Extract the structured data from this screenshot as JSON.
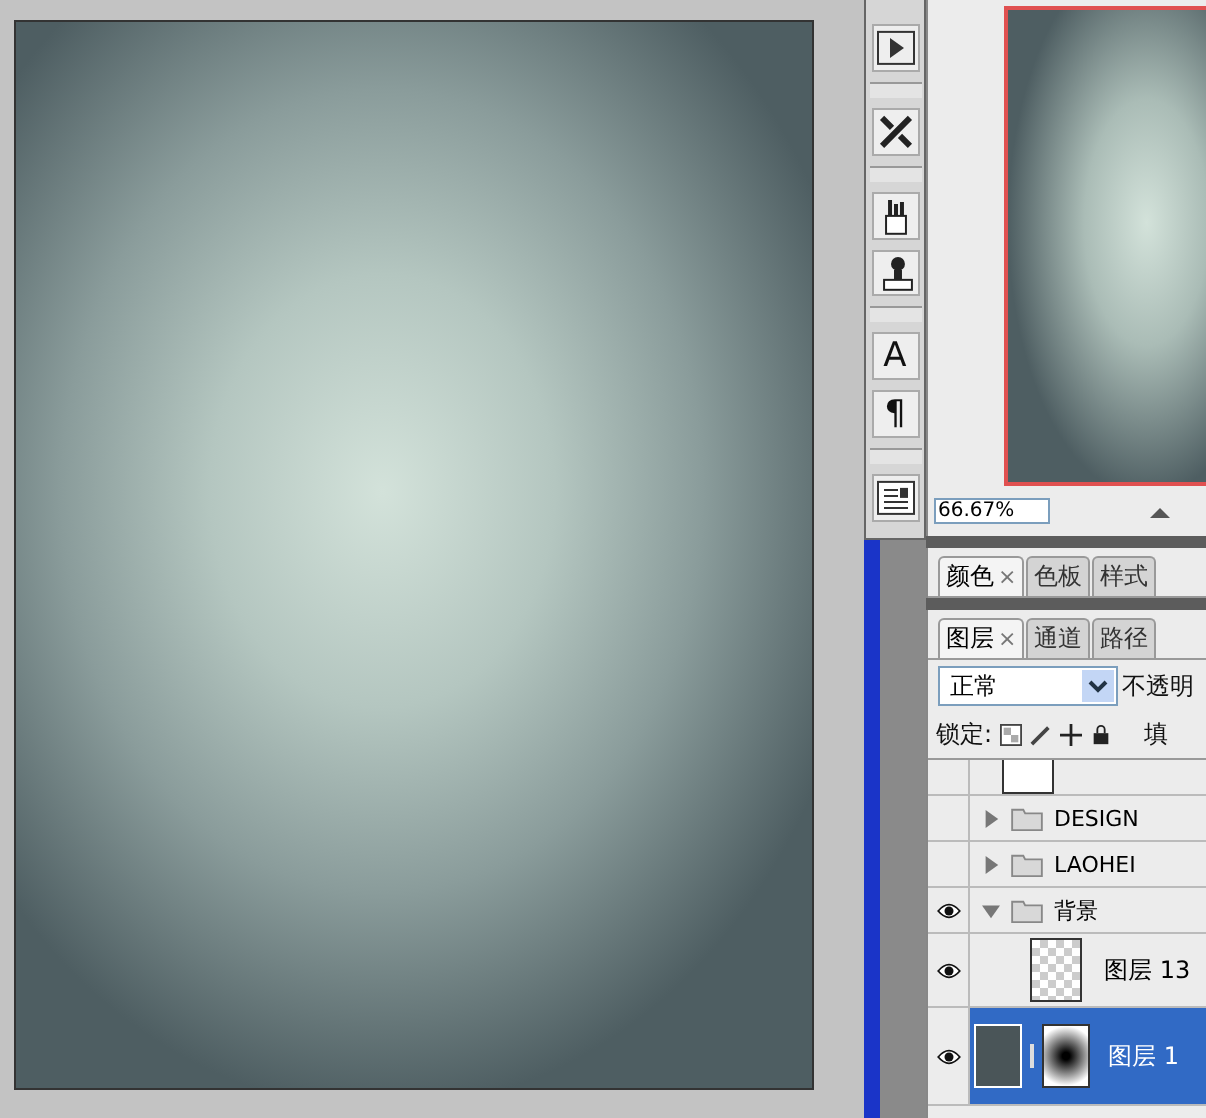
{
  "toolbar": [
    {
      "kind": "play"
    },
    {
      "kind": "tools"
    },
    {
      "kind": "brushes"
    },
    {
      "kind": "stamp"
    },
    {
      "kind": "glyph",
      "label": "A"
    },
    {
      "kind": "glyph",
      "label": "¶"
    },
    {
      "kind": "notes"
    }
  ],
  "navigator": {
    "zoom": "66.67%"
  },
  "color_panel": {
    "tabs": [
      {
        "label": "颜色",
        "selected": true,
        "close": "×"
      },
      {
        "label": "色板",
        "selected": false
      },
      {
        "label": "样式",
        "selected": false
      }
    ]
  },
  "layers_panel": {
    "tabs": [
      {
        "label": "图层",
        "selected": true,
        "close": "×"
      },
      {
        "label": "通道",
        "selected": false
      },
      {
        "label": "路径",
        "selected": false
      }
    ],
    "blend_mode": "正常",
    "opacity_label": "不透明",
    "lock_label": "锁定:",
    "fill_label": "填",
    "layers": [
      {
        "kind": "white-layer",
        "visible": false,
        "selected": false
      },
      {
        "kind": "group",
        "name": "DESIGN",
        "visible": false,
        "expanded": false
      },
      {
        "kind": "group",
        "name": "LAOHEI",
        "visible": false,
        "expanded": false
      },
      {
        "kind": "group",
        "name": "背景",
        "visible": true,
        "expanded": true,
        "children": [
          {
            "kind": "transparent-layer",
            "name": "图层 13",
            "visible": true,
            "selected": false
          },
          {
            "kind": "masked-layer",
            "name": "图层 1",
            "visible": true,
            "selected": true
          }
        ]
      }
    ]
  }
}
